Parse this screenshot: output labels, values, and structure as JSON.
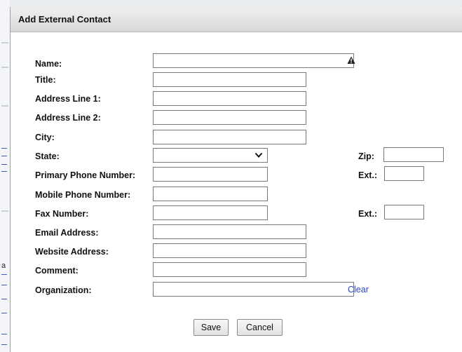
{
  "dialog": {
    "title": "Add External Contact"
  },
  "backdrop": {
    "text_a": "a"
  },
  "form": {
    "name_label": "Name:",
    "name_value": "",
    "title_label": "Title:",
    "title_value": "",
    "address1_label": "Address Line 1:",
    "address1_value": "",
    "address2_label": "Address Line 2:",
    "address2_value": "",
    "city_label": "City:",
    "city_value": "",
    "state_label": "State:",
    "state_value": "",
    "zip_label": "Zip:",
    "zip_value": "",
    "primary_phone_label": "Primary Phone Number:",
    "primary_phone_value": "",
    "ext1_label": "Ext.:",
    "ext1_value": "",
    "mobile_phone_label": "Mobile Phone Number:",
    "mobile_phone_value": "",
    "fax_label": "Fax Number:",
    "fax_value": "",
    "ext2_label": "Ext.:",
    "ext2_value": "",
    "email_label": "Email Address:",
    "email_value": "",
    "website_label": "Website Address:",
    "website_value": "",
    "comment_label": "Comment:",
    "comment_value": "",
    "organization_label": "Organization:",
    "organization_value": "",
    "clear_label": "Clear"
  },
  "buttons": {
    "save": "Save",
    "cancel": "Cancel"
  },
  "icons": {
    "required": "warning-triangle-icon",
    "dropdown": "chevron-down-icon"
  },
  "colors": {
    "link": "#2b45c8",
    "title_bar": "#dedede"
  }
}
